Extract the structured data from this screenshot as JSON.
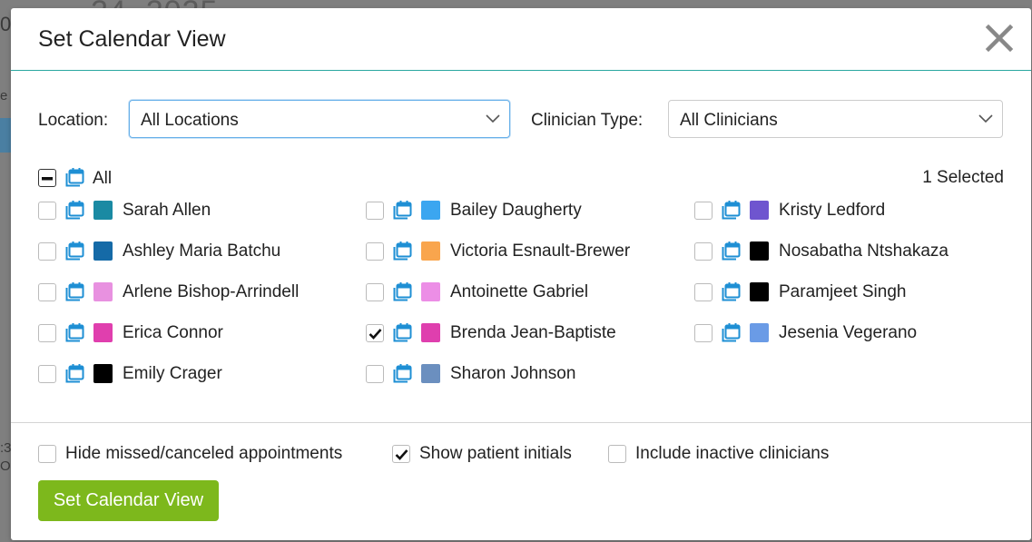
{
  "background": {
    "date_fragment": "24, 2025",
    "frag_left_1": "0",
    "frag_left_2": "e",
    "frag_left_3": ":3",
    "frag_left_4": "O"
  },
  "modal": {
    "title": "Set Calendar View",
    "close_icon": "close-icon"
  },
  "filters": {
    "location_label": "Location:",
    "location_value": "All Locations",
    "clinician_type_label": "Clinician Type:",
    "clinician_type_value": "All Clinicians"
  },
  "all": {
    "label": "All",
    "selected_text": "1 Selected",
    "state": "indeterminate"
  },
  "clinicians": [
    {
      "name": "Sarah Allen",
      "color": "#1a8aa3",
      "checked": false
    },
    {
      "name": "Ashley Maria Batchu",
      "color": "#156aa7",
      "checked": false
    },
    {
      "name": "Arlene Bishop-Arrindell",
      "color": "#e891e0",
      "checked": false
    },
    {
      "name": "Erica Connor",
      "color": "#e03fae",
      "checked": false
    },
    {
      "name": "Emily Crager",
      "color": "#000000",
      "checked": false
    },
    {
      "name": "Bailey Daugherty",
      "color": "#3ba6f0",
      "checked": false
    },
    {
      "name": "Victoria Esnault-Brewer",
      "color": "#f9a54d",
      "checked": false
    },
    {
      "name": "Antoinette Gabriel",
      "color": "#ec8ee6",
      "checked": false
    },
    {
      "name": "Brenda Jean-Baptiste",
      "color": "#df3fae",
      "checked": true
    },
    {
      "name": "Sharon Johnson",
      "color": "#6b8fbf",
      "checked": false
    },
    {
      "name": "Kristy Ledford",
      "color": "#6f55cf",
      "checked": false
    },
    {
      "name": "Nosabatha Ntshakaza",
      "color": "#000000",
      "checked": false
    },
    {
      "name": "Paramjeet Singh",
      "color": "#000000",
      "checked": false
    },
    {
      "name": "Jesenia Vegerano",
      "color": "#6a9be6",
      "checked": false
    }
  ],
  "options": [
    {
      "label": "Hide missed/canceled appointments",
      "checked": false
    },
    {
      "label": "Show patient initials",
      "checked": true
    },
    {
      "label": "Include inactive clinicians",
      "checked": false
    }
  ],
  "submit_label": "Set Calendar View",
  "colors": {
    "accent_teal": "#2aa7a0",
    "calendar_icon_blue": "#1e8fd4",
    "button_green": "#7db81c"
  }
}
